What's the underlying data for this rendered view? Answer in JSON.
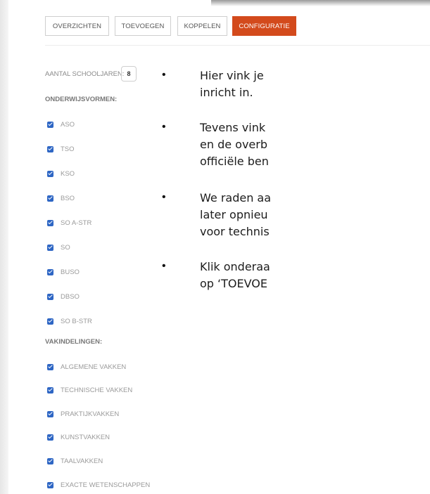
{
  "colors": {
    "accent": "#d34a1c",
    "checkbox": "#2e66c4"
  },
  "tabs": [
    {
      "label": "OVERZICHTEN"
    },
    {
      "label": "TOEVOEGEN"
    },
    {
      "label": "KOPPELEN"
    },
    {
      "label": "CONFIGURATIE",
      "active": true
    }
  ],
  "config": {
    "school_years_label": "AANTAL SCHOOLJAREN:",
    "school_years_value": "8",
    "education_forms_heading": "ONDERWIJSVORMEN:",
    "education_forms": [
      {
        "label": "ASO",
        "checked": true
      },
      {
        "label": "TSO",
        "checked": true
      },
      {
        "label": "KSO",
        "checked": true
      },
      {
        "label": "BSO",
        "checked": true
      },
      {
        "label": "SO A-STR",
        "checked": true
      },
      {
        "label": "SO",
        "checked": true
      },
      {
        "label": "BUSO",
        "checked": true
      },
      {
        "label": "DBSO",
        "checked": true
      },
      {
        "label": "SO B-STR",
        "checked": true
      }
    ],
    "subject_groups_heading": "VAKINDELINGEN:",
    "subject_groups": [
      {
        "label": "ALGEMENE VAKKEN",
        "checked": true
      },
      {
        "label": "TECHNISCHE VAKKEN",
        "checked": true
      },
      {
        "label": "PRAKTIJKVAKKEN",
        "checked": true
      },
      {
        "label": "KUNSTVAKKEN",
        "checked": true
      },
      {
        "label": "TAALVAKKEN",
        "checked": true
      },
      {
        "label": "EXACTE WETENSCHAPPEN",
        "checked": true
      }
    ]
  },
  "bullets": [
    {
      "symbol": "•",
      "lines": [
        "Hier vink je",
        "inricht in."
      ]
    },
    {
      "symbol": "•",
      "lines": [
        "Tevens vink",
        "en de overb",
        "officiële ben"
      ]
    },
    {
      "symbol": "•",
      "lines": [
        "We raden aa",
        "later opnieu",
        "voor technis"
      ]
    },
    {
      "symbol": "•",
      "lines": [
        "Klik onderaa",
        "op ‘TOEVOE"
      ]
    }
  ]
}
